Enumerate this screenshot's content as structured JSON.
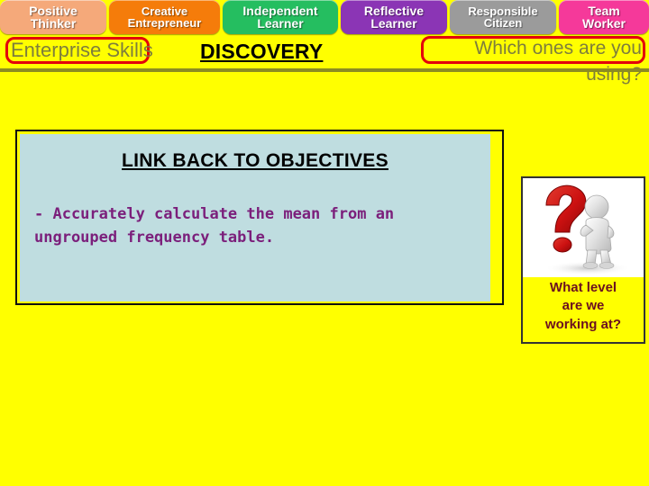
{
  "skills_bar": {
    "tabs": [
      {
        "line1": "Positive",
        "line2": "Thinker",
        "color": "#F5A97A",
        "name": "positive-thinker"
      },
      {
        "line1": "Creative",
        "line2": "Entrepreneur",
        "color": "#F57C0A",
        "name": "creative-entrepreneur"
      },
      {
        "line1": "Independent",
        "line2": "Learner",
        "color": "#25BE60",
        "name": "independent-learner"
      },
      {
        "line1": "Reflective",
        "line2": "Learner",
        "color": "#8B35B5",
        "name": "reflective-learner"
      },
      {
        "line1": "Responsible",
        "line2": "Citizen",
        "color": "#9B9B9B",
        "name": "responsible-citizen"
      },
      {
        "line1": "Team",
        "line2": "Worker",
        "color": "#F5399A",
        "name": "team-worker"
      }
    ]
  },
  "title_row": {
    "enterprise_skills": "Enterprise Skills",
    "discovery": "DISCOVERY",
    "which_ones_line1": "Which ones are you",
    "which_ones_line2": "using?",
    "highlight_color": "#E3000B",
    "label_color": "#7E7E3C"
  },
  "objectives": {
    "heading": "LINK BACK TO OBJECTIVES",
    "body": "- Accurately calculate the mean from an ungrouped frequency table.",
    "panel_color": "#BFDDE0",
    "body_color": "#7B1F7B"
  },
  "level_card": {
    "image_alt": "question-mark-thinker",
    "caption_line1": "What level",
    "caption_line2": "are we",
    "caption_line3": "working at?",
    "caption_color": "#6B1020",
    "question_mark_color": "#CC1111"
  },
  "page": {
    "background": "#FFFF00",
    "divider_color": "#8C8C22"
  }
}
